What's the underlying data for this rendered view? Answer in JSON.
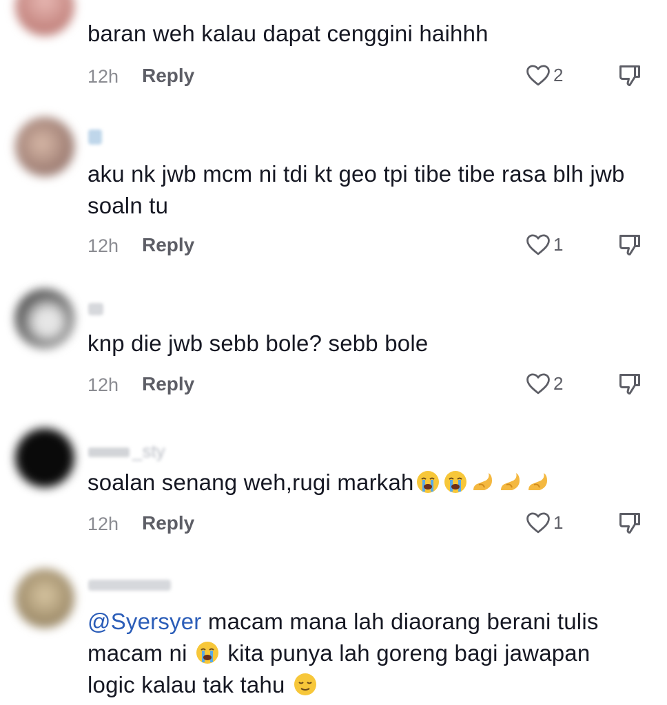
{
  "comments": [
    {
      "text": "baran weh kalau dapat cenggini haihhh",
      "time": "12h",
      "reply": "Reply",
      "likes": "2"
    },
    {
      "username": "",
      "text": "aku nk jwb mcm ni tdi kt geo tpi tibe tibe rasa blh jwb soaln tu",
      "time": "12h",
      "reply": "Reply",
      "likes": "1"
    },
    {
      "username": "",
      "text": "knp die jwb sebb bole? sebb bole",
      "time": "12h",
      "reply": "Reply",
      "likes": "2"
    },
    {
      "username": "_sty",
      "text": "soalan senang weh,rugi markah",
      "time": "12h",
      "reply": "Reply",
      "likes": "1"
    },
    {
      "username": "",
      "mention": "@Syersyer",
      "text_a": "macam mana lah diaorang berani tulis macam ni",
      "text_b": "kita punya lah goreng bagi jawapan logic kalau tak tahu"
    }
  ],
  "icons": {
    "like": "heart-outline-icon",
    "dislike": "thumbs-down-icon",
    "emoji_cry": "loudly-crying-face-emoji",
    "emoji_pinch": "pinching-hand-emoji",
    "emoji_relieved": "relieved-face-emoji"
  },
  "colors": {
    "text": "#161823",
    "meta": "#8a8b91",
    "reply": "#5d5e66",
    "mention": "#2b5db8"
  }
}
